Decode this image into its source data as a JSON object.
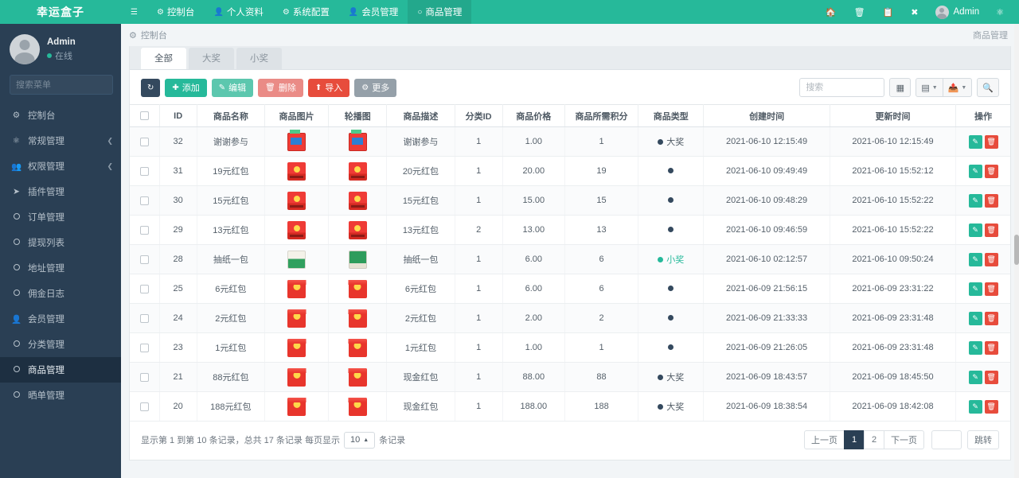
{
  "brand": "幸运盒子",
  "topnav": {
    "toggle_icon": "hamburger-icon",
    "items": [
      {
        "label": "控制台",
        "icon": "dashboard-icon",
        "active": false
      },
      {
        "label": "个人资料",
        "icon": "user-icon",
        "active": false
      },
      {
        "label": "系统配置",
        "icon": "gear-icon",
        "active": false
      },
      {
        "label": "会员管理",
        "icon": "user-icon",
        "active": false
      },
      {
        "label": "商品管理",
        "icon": "circle-icon",
        "active": true
      }
    ],
    "right_icons": [
      "home-icon",
      "trash-icon",
      "copy-icon",
      "fullscreen-icon"
    ],
    "user": "Admin",
    "settings_icon": "gears-icon"
  },
  "sidebar": {
    "profile": {
      "name": "Admin",
      "status": "在线"
    },
    "search_placeholder": "搜索菜单",
    "search_value": "",
    "items": [
      {
        "label": "控制台",
        "icon": "dashboard-icon",
        "caret": false,
        "active": false
      },
      {
        "label": "常规管理",
        "icon": "gears-icon",
        "caret": true,
        "active": false
      },
      {
        "label": "权限管理",
        "icon": "users-icon",
        "caret": true,
        "active": false
      },
      {
        "label": "插件管理",
        "icon": "plug-icon",
        "caret": false,
        "active": false
      },
      {
        "label": "订单管理",
        "icon": "circle-icon",
        "caret": false,
        "active": false
      },
      {
        "label": "提现列表",
        "icon": "circle-icon",
        "caret": false,
        "active": false
      },
      {
        "label": "地址管理",
        "icon": "circle-icon",
        "caret": false,
        "active": false
      },
      {
        "label": "佣金日志",
        "icon": "circle-icon",
        "caret": false,
        "active": false
      },
      {
        "label": "会员管理",
        "icon": "user-icon",
        "caret": false,
        "active": false
      },
      {
        "label": "分类管理",
        "icon": "circle-icon",
        "caret": false,
        "active": false
      },
      {
        "label": "商品管理",
        "icon": "circle-icon",
        "caret": false,
        "active": true
      },
      {
        "label": "晒单管理",
        "icon": "circle-icon",
        "caret": false,
        "active": false
      }
    ]
  },
  "breadcrumb": {
    "icon": "dashboard-icon",
    "text": "控制台",
    "right": "商品管理"
  },
  "tabs": [
    {
      "label": "全部",
      "active": true
    },
    {
      "label": "大奖",
      "active": false
    },
    {
      "label": "小奖",
      "active": false
    }
  ],
  "toolbar": {
    "refresh_icon": "refresh-icon",
    "add_label": "添加",
    "edit_label": "编辑",
    "delete_label": "删除",
    "import_label": "导入",
    "more_label": "更多",
    "search_placeholder": "搜索",
    "search_value": "",
    "columns_icon": "columns-icon",
    "grid_icon": "grid-icon",
    "export_icon": "export-icon",
    "filter_icon": "search-icon"
  },
  "table": {
    "headers": [
      "",
      "ID",
      "商品名称",
      "商品图片",
      "轮播图",
      "商品描述",
      "分类ID",
      "商品价格",
      "商品所需积分",
      "商品类型",
      "创建时间",
      "更新时间",
      "操作"
    ],
    "rows": [
      {
        "id": "32",
        "name": "谢谢参与",
        "thumb": "gift",
        "desc": "谢谢参与",
        "cat": "1",
        "price": "1.00",
        "points": "1",
        "type": "大奖",
        "type_color": "#34495e",
        "created": "2021-06-10 12:15:49",
        "updated": "2021-06-10 12:15:49"
      },
      {
        "id": "31",
        "name": "19元红包",
        "thumb": "env",
        "desc": "20元红包",
        "cat": "1",
        "price": "20.00",
        "points": "19",
        "type": "",
        "type_color": "#34495e",
        "created": "2021-06-10 09:49:49",
        "updated": "2021-06-10 15:52:12"
      },
      {
        "id": "30",
        "name": "15元红包",
        "thumb": "env",
        "desc": "15元红包",
        "cat": "1",
        "price": "15.00",
        "points": "15",
        "type": "",
        "type_color": "#34495e",
        "created": "2021-06-10 09:48:29",
        "updated": "2021-06-10 15:52:22"
      },
      {
        "id": "29",
        "name": "13元红包",
        "thumb": "env",
        "desc": "13元红包",
        "cat": "2",
        "price": "13.00",
        "points": "13",
        "type": "",
        "type_color": "#34495e",
        "created": "2021-06-10 09:46:59",
        "updated": "2021-06-10 15:52:22"
      },
      {
        "id": "28",
        "name": "抽纸一包",
        "thumb": "tissue",
        "desc": "抽纸一包",
        "cat": "1",
        "price": "6.00",
        "points": "6",
        "type": "小奖",
        "type_color": "#26b99a",
        "created": "2021-06-10 02:12:57",
        "updated": "2021-06-10 09:50:24"
      },
      {
        "id": "25",
        "name": "6元红包",
        "thumb": "env2",
        "desc": "6元红包",
        "cat": "1",
        "price": "6.00",
        "points": "6",
        "type": "",
        "type_color": "#34495e",
        "created": "2021-06-09 21:56:15",
        "updated": "2021-06-09 23:31:22"
      },
      {
        "id": "24",
        "name": "2元红包",
        "thumb": "env2",
        "desc": "2元红包",
        "cat": "1",
        "price": "2.00",
        "points": "2",
        "type": "",
        "type_color": "#34495e",
        "created": "2021-06-09 21:33:33",
        "updated": "2021-06-09 23:31:48"
      },
      {
        "id": "23",
        "name": "1元红包",
        "thumb": "env2",
        "desc": "1元红包",
        "cat": "1",
        "price": "1.00",
        "points": "1",
        "type": "",
        "type_color": "#34495e",
        "created": "2021-06-09 21:26:05",
        "updated": "2021-06-09 23:31:48"
      },
      {
        "id": "21",
        "name": "88元红包",
        "thumb": "env2",
        "desc": "现金红包",
        "cat": "1",
        "price": "88.00",
        "points": "88",
        "type": "大奖",
        "type_color": "#34495e",
        "created": "2021-06-09 18:43:57",
        "updated": "2021-06-09 18:45:50"
      },
      {
        "id": "20",
        "name": "188元红包",
        "thumb": "env2",
        "desc": "现金红包",
        "cat": "1",
        "price": "188.00",
        "points": "188",
        "type": "大奖",
        "type_color": "#34495e",
        "created": "2021-06-09 18:38:54",
        "updated": "2021-06-09 18:42:08"
      }
    ],
    "row_actions": {
      "edit_icon": "pencil-icon",
      "delete_icon": "trash-icon"
    }
  },
  "footer": {
    "info_prefix": "显示第 1 到第 10 条记录，总共 17 条记录 每页显示",
    "page_size": "10",
    "info_suffix": "条记录",
    "prev": "上一页",
    "pages": [
      "1",
      "2"
    ],
    "active_page": "1",
    "next": "下一页",
    "jump_value": "",
    "jump_label": "跳转"
  }
}
